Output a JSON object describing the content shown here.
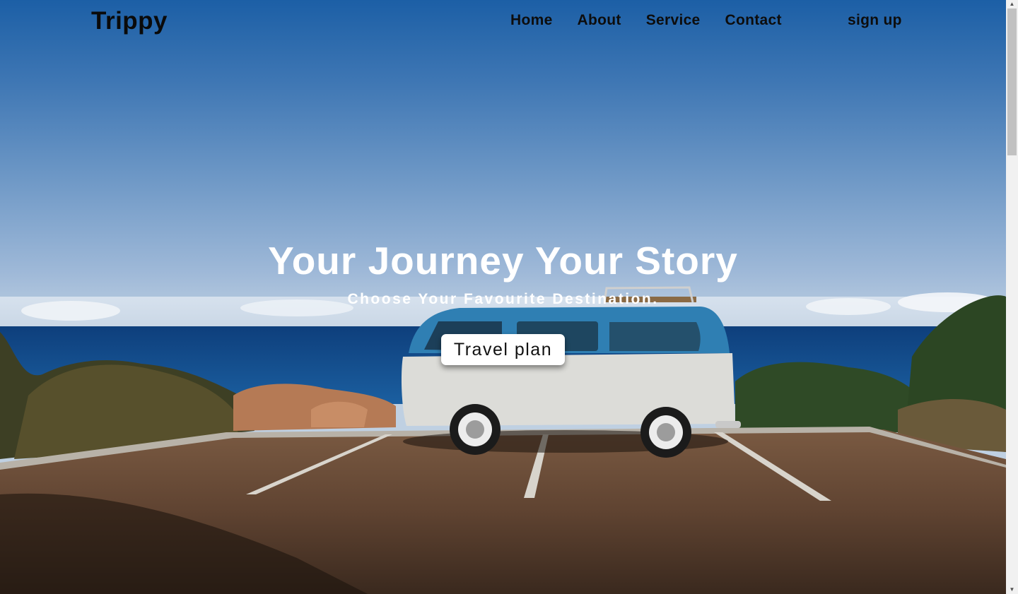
{
  "brand": {
    "name": "Trippy"
  },
  "nav": {
    "items": [
      {
        "label": "Home"
      },
      {
        "label": "About"
      },
      {
        "label": "Service"
      },
      {
        "label": "Contact"
      }
    ],
    "signup_label": "sign up"
  },
  "hero": {
    "headline": "Your Journey Your Story",
    "subheadline": "Choose Your Favourite Destination.",
    "cta_label": "Travel plan",
    "background": "camper van parked by the sea"
  },
  "colors": {
    "sky_top": "#1c5fa6",
    "sea": "#134f8e",
    "van_blue": "#2f7fb3",
    "van_white": "#dcdcd8"
  },
  "scrollbar": {
    "up_icon": "triangle-up-icon",
    "down_icon": "triangle-down-icon"
  }
}
